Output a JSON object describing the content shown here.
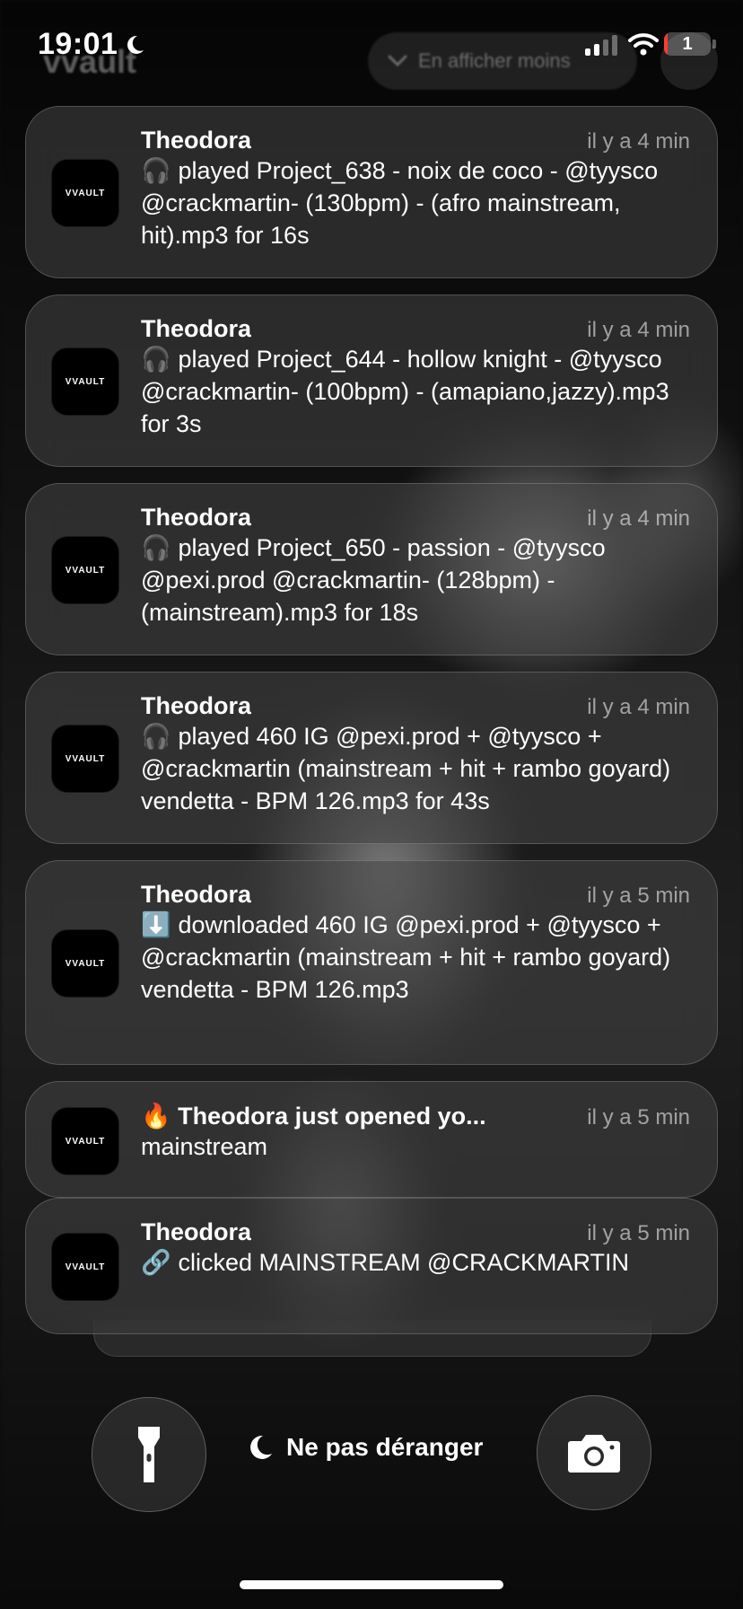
{
  "background": {
    "title": "vvault",
    "pill_label": "En afficher moins"
  },
  "status_bar": {
    "time": "19:01",
    "battery_level": "1",
    "signal_bars_active": 2,
    "signal_bars_total": 4
  },
  "notifications": [
    {
      "app": "VVAULT",
      "title": "Theodora",
      "time": "il y a 4 min",
      "emoji": "🎧",
      "body": "played Project_638 - noix de coco - @tyysco @crackmartin- (130bpm)  - (afro mainstream, hit).mp3 for 16s"
    },
    {
      "app": "VVAULT",
      "title": "Theodora",
      "time": "il y a 4 min",
      "emoji": "🎧",
      "body": "played Project_644 - hollow knight - @tyysco @crackmartin- (100bpm)  - (amapiano,jazzy).mp3 for 3s"
    },
    {
      "app": "VVAULT",
      "title": "Theodora",
      "time": "il y a 4 min",
      "emoji": "🎧",
      "body": "played Project_650 - passion - @tyysco @pexi.prod @crackmartin- (128bpm)  - (mainstream).mp3 for 18s"
    },
    {
      "app": "VVAULT",
      "title": "Theodora",
      "time": "il y a 4 min",
      "emoji": "🎧",
      "body": "played 460 IG @pexi.prod + @tyysco + @crackmartin (mainstream + hit + rambo goyard) vendetta - BPM 126.mp3 for 43s"
    },
    {
      "app": "VVAULT",
      "title": "Theodora",
      "time": "il y a 5 min",
      "emoji": "⬇️",
      "body": "downloaded 460 IG @pexi.prod + @tyysco + @crackmartin (mainstream + hit + rambo goyard) vendetta - BPM 126.mp3"
    },
    {
      "app": "VVAULT",
      "title": "🔥 Theodora just opened yo...",
      "time": "il y a 5 min",
      "emoji": "",
      "body": "mainstream"
    },
    {
      "app": "VVAULT",
      "title": "Theodora",
      "time": "il y a 5 min",
      "emoji": "🔗",
      "body": "clicked MAINSTREAM @CRACKMARTIN"
    }
  ],
  "controls": {
    "focus_label": "Ne pas déranger"
  }
}
